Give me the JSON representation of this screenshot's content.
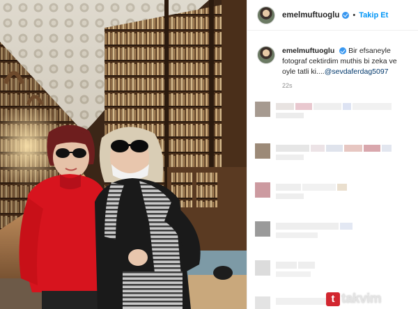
{
  "post": {
    "username": "emelmuftuoglu",
    "follow_label": "Takip Et",
    "caption_text": "Bir efsaneyle fotograf cektirdim muthis bi zeka ve oyle tatli ki....",
    "caption_mention": "@sevdaferdag5097",
    "time": "22s"
  },
  "watermark": "takvim",
  "colors": {
    "follow_blue": "#0095f6",
    "verified_blue": "#3897f0",
    "mention": "#00376b",
    "muted": "#8e8e8e"
  }
}
